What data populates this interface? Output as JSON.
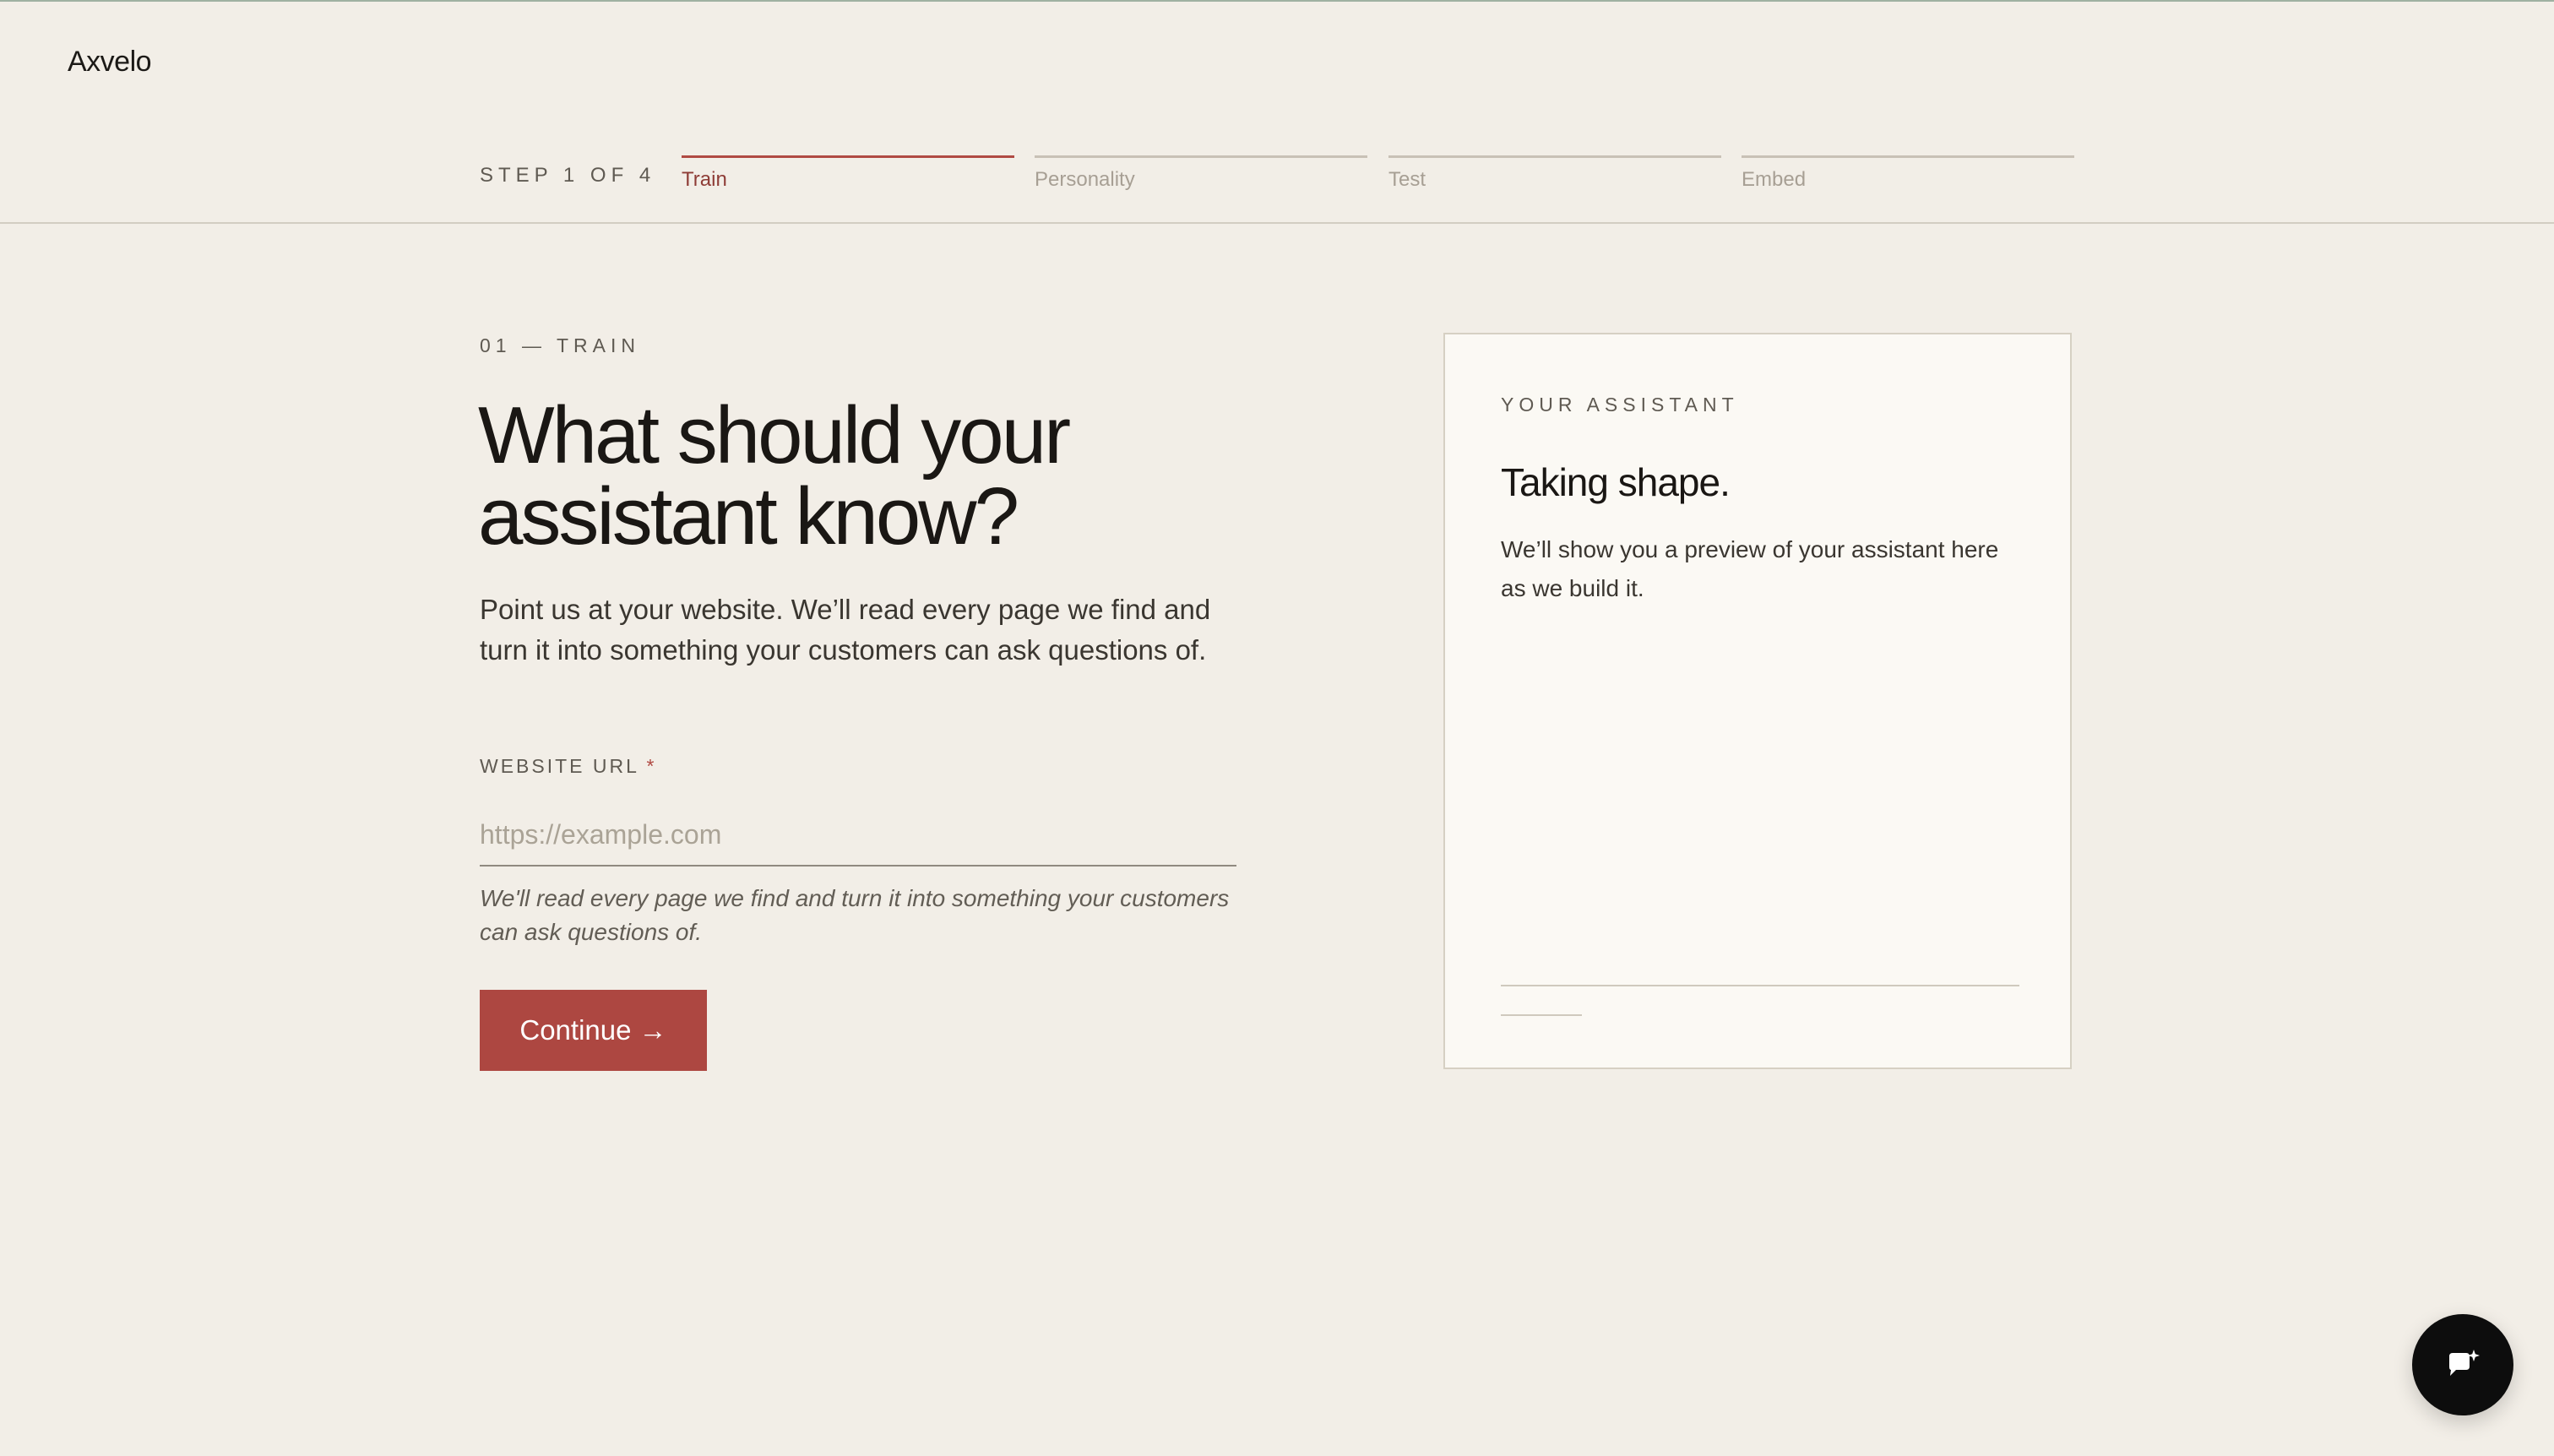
{
  "brand": {
    "name": "Axvelo"
  },
  "progress": {
    "step_label": "STEP 1 OF 4",
    "current_step": 1,
    "total_steps": 4,
    "steps": [
      {
        "label": "Train",
        "active": true
      },
      {
        "label": "Personality",
        "active": false
      },
      {
        "label": "Test",
        "active": false
      },
      {
        "label": "Embed",
        "active": false
      }
    ]
  },
  "main": {
    "eyebrow": "01 — TRAIN",
    "headline": "What should your assistant know?",
    "intro": "Point us at your website. We’ll read every page we find and turn it into something your customers can ask questions of.",
    "field": {
      "label": "WEBSITE URL",
      "required_mark": "*",
      "value": "",
      "placeholder": "https://example.com",
      "helper": "We'll read every page we find and turn it into something your customers can ask questions of."
    },
    "continue_label": "Continue →"
  },
  "preview": {
    "eyebrow": "YOUR ASSISTANT",
    "title": "Taking shape.",
    "text": "We’ll show you a preview of your assistant here as we build it."
  },
  "chat_launcher": {
    "icon": "chat-sparkle-icon"
  },
  "colors": {
    "background": "#f2eee7",
    "accent": "#ad4741",
    "text": "#1c1a17",
    "card": "#fbf9f4",
    "fab": "#0d0d0d"
  }
}
